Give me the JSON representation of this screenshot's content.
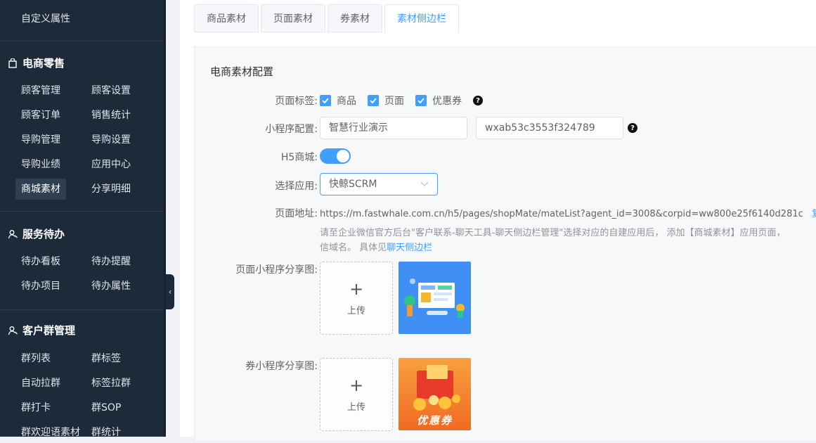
{
  "sidebar": {
    "top_item": "自定义属性",
    "sections": [
      {
        "title": "电商零售",
        "items": [
          "顾客管理",
          "顾客设置",
          "顾客订单",
          "销售统计",
          "导购管理",
          "导购设置",
          "导购业绩",
          "应用中心",
          "商城素材",
          "分享明细"
        ]
      },
      {
        "title": "服务待办",
        "items": [
          "待办看板",
          "待办提醒",
          "待办项目",
          "待办属性"
        ]
      },
      {
        "title": "客户群管理",
        "items": [
          "群列表",
          "群标签",
          "自动拉群",
          "标签拉群",
          "群打卡",
          "群SOP",
          "群欢迎语素材",
          "群统计"
        ]
      }
    ],
    "active_item": "商城素材"
  },
  "tabs": [
    "商品素材",
    "页面素材",
    "券素材",
    "素材侧边栏"
  ],
  "active_tab": "素材侧边栏",
  "form": {
    "title": "电商素材配置",
    "page_tags_label": "页面标签:",
    "page_tags": [
      "商品",
      "页面",
      "优惠券"
    ],
    "mini_program_label": "小程序配置:",
    "mini_program_name": "智慧行业演示",
    "mini_program_appid": "wxab53c3553f324789",
    "h5_label": "H5商城:",
    "h5_enabled": true,
    "app_label": "选择应用:",
    "app_value": "快鲸SCRM",
    "url_label": "页面地址:",
    "url_value": "https://m.fastwhale.com.cn/h5/pages/shopMate/mateList?agent_id=3008&corpid=ww800e25f6140d281c",
    "copy_label": "复制",
    "hint_line1": "请至企业微信官方后台\"客户联系-聊天工具-聊天侧边栏管理\"选择对应的自建应用后， 添加【商城素材】应用页面，",
    "hint_line2_prefix": "信域名。 具体见",
    "hint_link": "聊天侧边栏",
    "page_share_label": "页面小程序分享图:",
    "coupon_share_label": "券小程序分享图:",
    "upload_plus": "+",
    "upload_text": "上传",
    "coupon_image_text": "优惠券",
    "help_glyph": "?"
  },
  "colors": {
    "accent": "#409eff",
    "sidebar_bg": "#1c2a3a"
  }
}
